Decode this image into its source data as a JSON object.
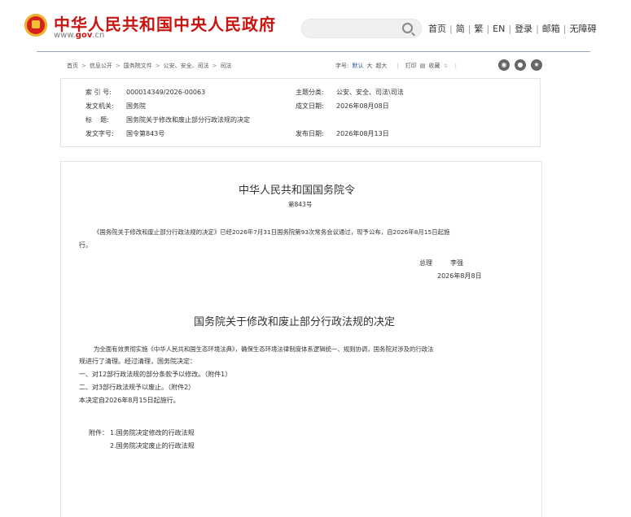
{
  "header": {
    "site_title": "中华人民共和国中央人民政府",
    "site_url_pre": "www.",
    "site_url_mid": "gov",
    "site_url_post": ".cn",
    "search_placeholder": "",
    "nav": [
      "首页",
      "简",
      "繁",
      "EN",
      "登录",
      "邮箱",
      "无障碍"
    ]
  },
  "breadcrumb": [
    "首页",
    "信息公开",
    "国务院文件",
    "公安、安全、司法",
    "司法"
  ],
  "tools": {
    "font_label": "字号:",
    "font_default": "默认",
    "font_large": "大",
    "font_xlarge": "超大",
    "print": "打印",
    "favorite": "收藏"
  },
  "meta": {
    "index_k": "索 引 号:",
    "index_v": "000014349/2026-00063",
    "topic_k": "主题分类:",
    "topic_v": "公安、安全、司法\\司法",
    "issuer_k": "发文机关:",
    "issuer_v": "国务院",
    "date_k": "成文日期:",
    "date_v": "2026年08月08日",
    "title_k": "标    题:",
    "title_v": "国务院关于修改和废止部分行政法规的决定",
    "docno_k": "发文字号:",
    "docno_v": "国令第843号",
    "pub_k": "发布日期:",
    "pub_v": "2026年08月13日"
  },
  "doc": {
    "order_title": "中华人民共和国国务院令",
    "order_no": "第843号",
    "order_body_1": "《国务院关于修改和废止部分行政法规的决定》已经2026年7月31日国务院第93次常务会议通过，现予公布，自2026年8月15日起施",
    "order_body_2": "行。",
    "sign_title": "总理",
    "sign_name": "李强",
    "sign_date": "2026年8月8日",
    "decision_title": "国务院关于修改和废止部分行政法规的决定",
    "para1_a": "为全面有效贯彻实施《中华人民共和国生态环境法典》，确保生态环境法律制度体系逻辑统一、规则协调，国务院对涉及的行政法",
    "para1_b": "规进行了清理。经过清理，国务院决定：",
    "item1": "一、对12部行政法规的部分条款予以修改。（附件1）",
    "item2": "二、对3部行政法规予以废止。（附件2）",
    "effective": "本决定自2026年8月15日起施行。",
    "attach_label": "附件：",
    "attach1": "1.国务院决定修改的行政法规",
    "attach2": "2.国务院决定废止的行政法规"
  }
}
